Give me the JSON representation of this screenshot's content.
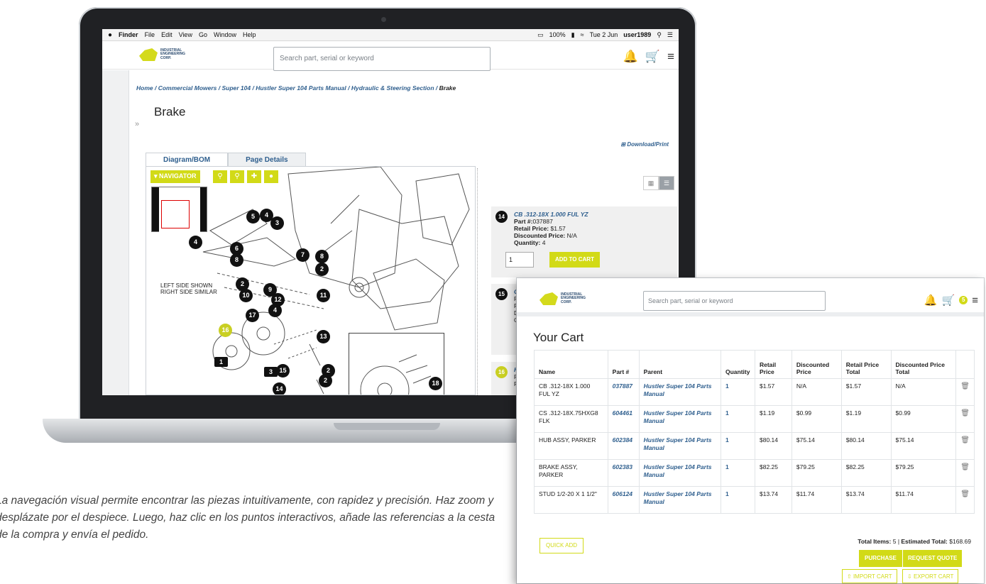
{
  "menubar": {
    "apple": "",
    "items": [
      "Finder",
      "File",
      "Edit",
      "View",
      "Go",
      "Window",
      "Help"
    ],
    "battery": "100%",
    "datetime": "Tue 2 Jun",
    "user": "user1989"
  },
  "header": {
    "logo_text": "INDUSTRIAL ENGINEERING CORP.",
    "search_placeholder": "Search part, serial or keyword"
  },
  "breadcrumb": {
    "items": [
      "Home",
      "Commercial Mowers",
      "Super 104",
      "Hustler Super 104 Parts Manual",
      "Hydraulic & Steering Section"
    ],
    "current": "Brake"
  },
  "page": {
    "title": "Brake",
    "download_label": "Download/Print",
    "tabs": [
      "Diagram/BOM",
      "Page Details"
    ]
  },
  "viewer": {
    "navigator_label": "NAVIGATOR",
    "side_note_1": "LEFT SIDE SHOWN",
    "side_note_2": "RIGHT SIDE SIMILAR",
    "callouts": [
      "5",
      "4",
      "3",
      "4",
      "6",
      "8",
      "7",
      "8",
      "2",
      "2",
      "10",
      "9",
      "12",
      "11",
      "4",
      "17",
      "16",
      "13",
      "2",
      "1",
      "3",
      "15",
      "2",
      "10",
      "14",
      "18"
    ]
  },
  "bom": {
    "cards": [
      {
        "num": "14",
        "name": "CB .312-18X 1.000 FUL YZ",
        "part_label": "Part #:",
        "part": "037887",
        "retail_label": "Retail Price:",
        "retail": "$1.57",
        "disc_label": "Discounted Price:",
        "disc": "N/A",
        "qty_label": "Quantity:",
        "qty": "4",
        "qty_input": "1",
        "add_label": "ADD TO CART"
      },
      {
        "num": "15",
        "name": "C",
        "p": "P",
        "r": "R",
        "d": "D",
        "c": "C"
      },
      {
        "num": "16",
        "name": "H",
        "p": "P",
        "r": "R"
      }
    ]
  },
  "cart": {
    "logo_text": "INDUSTRIAL ENGINEERING CORP.",
    "search_placeholder": "Search part, serial or keyword",
    "badge": "5",
    "title": "Your Cart",
    "columns": [
      "Name",
      "Part #",
      "Parent",
      "Quantity",
      "Retail Price",
      "Discounted Price",
      "Retail Price Total",
      "Discounted Price Total"
    ],
    "rows": [
      {
        "name": "CB .312-18X 1.000 FUL YZ",
        "part": "037887",
        "parent": "Hustler Super 104 Parts Manual",
        "qty": "1",
        "retail": "$1.57",
        "disc": "N/A",
        "rtotal": "$1.57",
        "dtotal": "N/A"
      },
      {
        "name": "CS .312-18X.75HXG8 FLK",
        "part": "604461",
        "parent": "Hustler Super 104 Parts Manual",
        "qty": "1",
        "retail": "$1.19",
        "disc": "$0.99",
        "rtotal": "$1.19",
        "dtotal": "$0.99"
      },
      {
        "name": "HUB ASSY, PARKER",
        "part": "602384",
        "parent": "Hustler Super 104 Parts Manual",
        "qty": "1",
        "retail": "$80.14",
        "disc": "$75.14",
        "rtotal": "$80.14",
        "dtotal": "$75.14"
      },
      {
        "name": "BRAKE ASSY, PARKER",
        "part": "602383",
        "parent": "Hustler Super 104 Parts Manual",
        "qty": "1",
        "retail": "$82.25",
        "disc": "$79.25",
        "rtotal": "$82.25",
        "dtotal": "$79.25"
      },
      {
        "name": "STUD 1/2-20 X 1 1/2\"",
        "part": "606124",
        "parent": "Hustler Super 104 Parts Manual",
        "qty": "1",
        "retail": "$13.74",
        "disc": "$11.74",
        "rtotal": "$13.74",
        "dtotal": "$11.74"
      }
    ],
    "quick_add": "QUICK ADD",
    "total_items_label": "Total Items:",
    "total_items": "5",
    "estimated_label": "Estimated Total:",
    "estimated": "$168.69",
    "purchase": "PURCHASE",
    "request_quote": "REQUEST QUOTE",
    "import": "IMPORT CART",
    "export": "EXPORT CART"
  },
  "caption": "La navegación visual permite encontrar las piezas intuitivamente, con rapidez y precisión. Haz zoom y desplázate por el despiece. Luego, haz clic en los puntos interactivos, añade las referencias a la cesta de la compra y envía el pedido."
}
